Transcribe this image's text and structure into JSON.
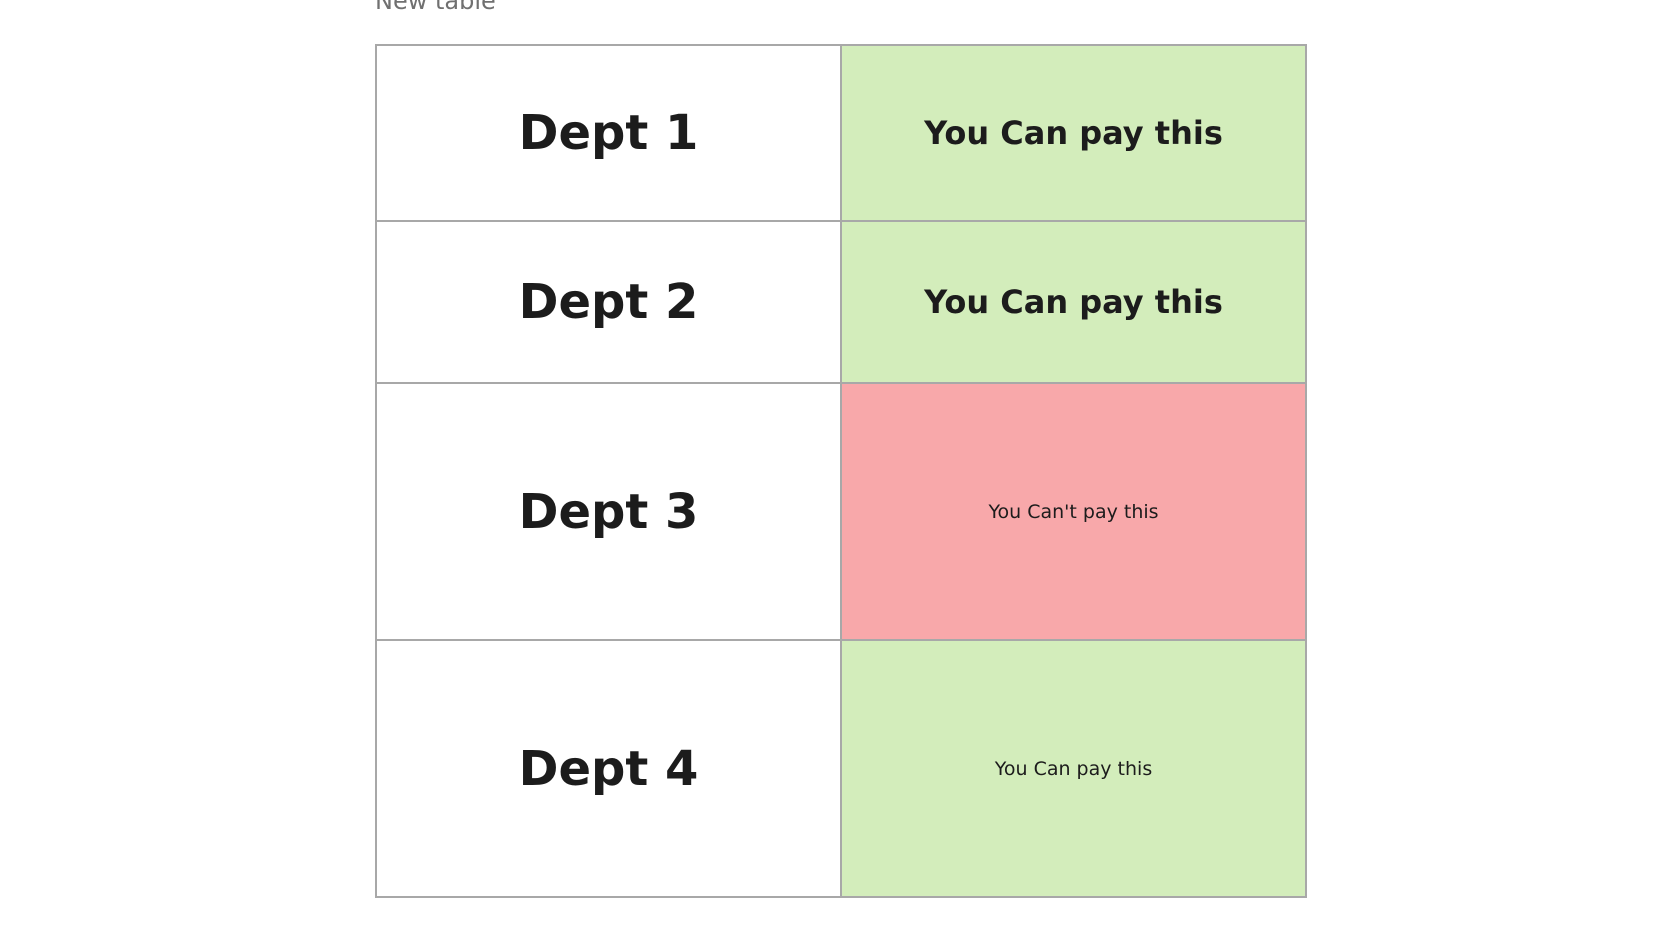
{
  "caption": "New table",
  "colors": {
    "pay_ok": "#d3edbb",
    "pay_no": "#f8a8aa",
    "border": "#a8a8a8"
  },
  "rows": [
    {
      "dept": "Dept 1",
      "status": "You Can pay this",
      "status_style": "bold",
      "status_color": "#d3edbb"
    },
    {
      "dept": "Dept 2",
      "status": "You Can pay this",
      "status_style": "bold",
      "status_color": "#d3edbb"
    },
    {
      "dept": "Dept 3",
      "status": "You Can't pay this",
      "status_style": "normal",
      "status_color": "#f8a8aa"
    },
    {
      "dept": "Dept 4",
      "status": "You Can pay this",
      "status_style": "normal",
      "status_color": "#d3edbb"
    }
  ]
}
